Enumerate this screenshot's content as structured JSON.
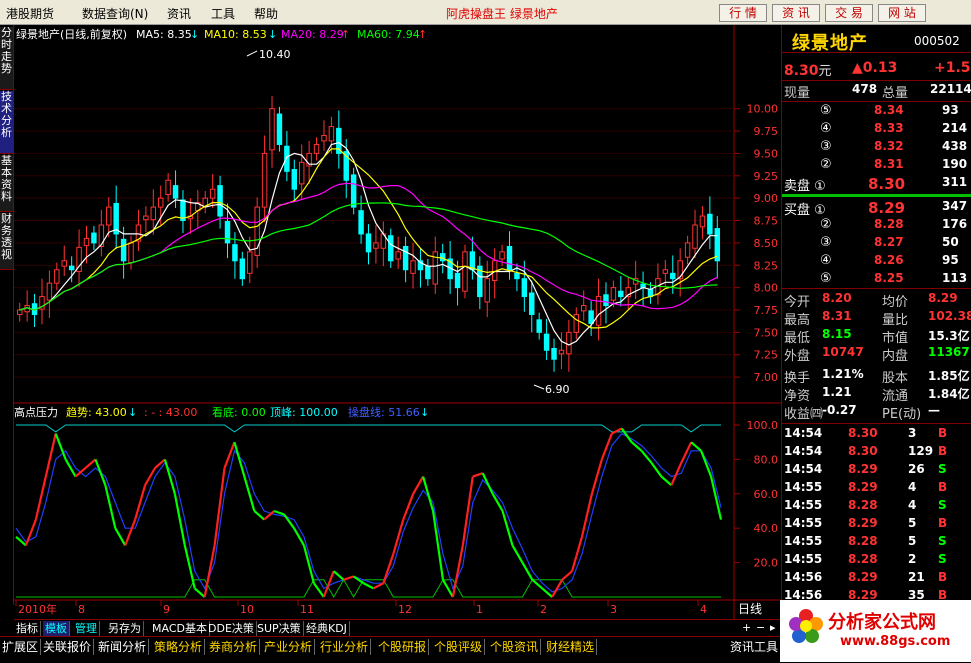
{
  "menu": {
    "items": [
      "港股期货",
      "数据查询(N)",
      "资讯",
      "工具",
      "帮助"
    ],
    "app_title": "阿虎操盘王  绿景地产",
    "buttons": [
      "行 情",
      "资 讯",
      "交 易",
      "网 站"
    ]
  },
  "left_tabs": [
    "分时走势",
    "技术分析",
    "基本资料",
    "财务透视"
  ],
  "main_legend": {
    "title": "绿景地产(日线,前复权)",
    "ma5": "MA5: 8.35",
    "ma10": "MA10: 8.53",
    "ma20": "MA20: 8.29",
    "ma60": "MA60: 7.94",
    "arrow": "↓",
    "uparrow": "↑",
    "colors": {
      "ma5": "#ffffff",
      "ma10": "#ffff00",
      "ma20": "#ff00ff",
      "ma60": "#00ff00"
    }
  },
  "sub_legend": {
    "title": "高点压力",
    "qs": "趋势: 43.00",
    "dash": ": - : 43.00",
    "kd": "看底: 0.00",
    "df": "顶峰: 100.00",
    "cpx": "操盘线: 51.66"
  },
  "annotations": {
    "high": "10.40",
    "low": "6.90"
  },
  "time_labels": [
    "2010年",
    "8",
    "9",
    "10",
    "11",
    "12",
    "1",
    "2",
    "3",
    "4"
  ],
  "period_label": "日线",
  "chart_data": [
    {
      "type": "candlestick",
      "title": "绿景地产(日线,前复权)",
      "ylim": [
        6.8,
        10.6
      ],
      "yticks": [
        10.0,
        9.75,
        9.5,
        9.25,
        9.0,
        8.75,
        8.5,
        8.25,
        8.0,
        7.75,
        7.5,
        7.25,
        7.0
      ],
      "close": [
        7.75,
        7.8,
        7.7,
        7.9,
        8.05,
        8.2,
        8.3,
        8.2,
        8.45,
        8.55,
        8.5,
        8.7,
        8.9,
        8.6,
        8.3,
        8.5,
        8.7,
        8.8,
        8.9,
        9.0,
        9.2,
        9.0,
        8.75,
        8.8,
        8.95,
        9.0,
        9.1,
        8.8,
        8.5,
        8.3,
        8.1,
        8.4,
        8.9,
        9.5,
        10.0,
        9.6,
        9.3,
        9.1,
        9.4,
        9.5,
        9.6,
        9.7,
        9.8,
        9.5,
        9.2,
        8.9,
        8.6,
        8.4,
        8.5,
        8.6,
        8.3,
        8.4,
        8.2,
        8.3,
        8.2,
        8.1,
        8.4,
        8.3,
        8.1,
        8.0,
        8.4,
        8.2,
        7.9,
        8.1,
        8.3,
        8.4,
        8.2,
        8.1,
        7.9,
        7.7,
        7.5,
        7.3,
        7.2,
        7.3,
        7.5,
        7.7,
        7.8,
        7.6,
        7.9,
        7.8,
        8.0,
        7.9,
        8.0,
        8.1,
        8.0,
        7.9,
        8.1,
        8.2,
        8.1,
        8.3,
        8.5,
        8.7,
        8.8,
        8.6,
        8.3
      ],
      "ma_values": {
        "MA5": 8.35,
        "MA10": 8.53,
        "MA20": 8.29,
        "MA60": 7.94
      }
    },
    {
      "type": "line",
      "title": "高点压力",
      "ylim": [
        0,
        100
      ],
      "yticks": [
        100.0,
        80.0,
        60.0,
        40.0,
        20.0
      ],
      "series": [
        {
          "name": "趋势",
          "values": [
            35,
            30,
            45,
            70,
            95,
            80,
            70,
            75,
            80,
            65,
            40,
            30,
            45,
            65,
            75,
            80,
            60,
            30,
            5,
            0,
            30,
            75,
            90,
            70,
            50,
            45,
            50,
            48,
            40,
            30,
            8,
            0,
            15,
            10,
            12,
            8,
            5,
            8,
            25,
            45,
            60,
            70,
            50,
            10,
            0,
            30,
            70,
            72,
            60,
            50,
            30,
            20,
            10,
            5,
            0,
            10,
            15,
            35,
            60,
            80,
            95,
            98,
            90,
            85,
            78,
            70,
            65,
            78,
            90,
            85,
            70,
            45
          ]
        },
        {
          "name": "操盘线",
          "values": [
            40,
            32,
            35,
            55,
            80,
            85,
            75,
            70,
            75,
            70,
            55,
            40,
            40,
            55,
            70,
            78,
            70,
            45,
            15,
            5,
            20,
            60,
            85,
            78,
            60,
            50,
            48,
            47,
            45,
            35,
            15,
            5,
            8,
            10,
            12,
            10,
            8,
            8,
            18,
            38,
            52,
            62,
            55,
            25,
            5,
            18,
            55,
            68,
            62,
            55,
            40,
            28,
            15,
            8,
            3,
            5,
            10,
            25,
            48,
            70,
            88,
            95,
            92,
            88,
            82,
            75,
            70,
            72,
            85,
            85,
            75,
            52
          ]
        }
      ]
    }
  ],
  "quote": {
    "name": "绿景地产",
    "code": "000502",
    "price": "8.30",
    "unit": "元",
    "change": "▲0.13",
    "change_pct": "+1.5",
    "volume_row": {
      "xl_label": "现量",
      "xl": "478",
      "zl_label": "总量",
      "zl": "22114"
    },
    "sell": [
      {
        "label": "⑤",
        "price": "8.34",
        "vol": "93"
      },
      {
        "label": "④",
        "price": "8.33",
        "vol": "214"
      },
      {
        "label": "③",
        "price": "8.32",
        "vol": "438"
      },
      {
        "label": "②",
        "price": "8.31",
        "vol": "190"
      },
      {
        "label": "卖盘 ①",
        "price": "8.30",
        "vol": "311"
      }
    ],
    "buy": [
      {
        "label": "买盘 ①",
        "price": "8.29",
        "vol": "347"
      },
      {
        "label": "②",
        "price": "8.28",
        "vol": "176"
      },
      {
        "label": "③",
        "price": "8.27",
        "vol": "50"
      },
      {
        "label": "④",
        "price": "8.26",
        "vol": "95"
      },
      {
        "label": "⑤",
        "price": "8.25",
        "vol": "113"
      }
    ],
    "stats": [
      [
        "今开",
        "8.20",
        "均价",
        "8.29"
      ],
      [
        "最高",
        "8.31",
        "量比",
        "102.38"
      ],
      [
        "最低",
        "8.15",
        "市值",
        "15.3亿"
      ],
      [
        "外盘",
        "10747",
        "内盘",
        "11367"
      ],
      [
        "换手",
        "1.21%",
        "股本",
        "1.85亿"
      ],
      [
        "净资",
        "1.21",
        "流通",
        "1.84亿"
      ],
      [
        "收益㈣",
        "-0.27",
        "PE(动)",
        "—"
      ]
    ],
    "ticks": [
      [
        "14:54",
        "8.30",
        "3",
        "B"
      ],
      [
        "14:54",
        "8.30",
        "129",
        "B"
      ],
      [
        "14:54",
        "8.29",
        "26",
        "S"
      ],
      [
        "14:55",
        "8.29",
        "4",
        "B"
      ],
      [
        "14:55",
        "8.28",
        "4",
        "S"
      ],
      [
        "14:55",
        "8.29",
        "5",
        "B"
      ],
      [
        "14:55",
        "8.28",
        "5",
        "S"
      ],
      [
        "14:55",
        "8.28",
        "2",
        "S"
      ],
      [
        "14:56",
        "8.29",
        "21",
        "B"
      ],
      [
        "14:56",
        "8.29",
        "35",
        "B"
      ]
    ]
  },
  "tabs2": [
    "指标",
    "模板",
    "管理",
    "另存为",
    "MACD基本",
    "DDE决策",
    "SUP决策",
    "经典KDJ"
  ],
  "bottom": [
    "扩展区",
    "关联报价",
    "新闻分析",
    "策略分析",
    "券商分析",
    "产业分析",
    "行业分析",
    "个股研报",
    "个股评级",
    "个股资讯",
    "财经精选",
    "资讯工具"
  ],
  "logo": {
    "text": "分析家公式网",
    "url": "www.88gs.com"
  }
}
